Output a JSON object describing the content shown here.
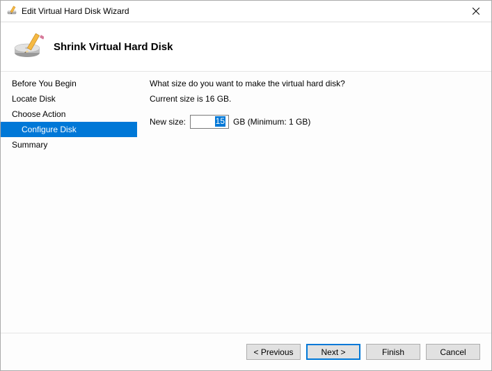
{
  "window": {
    "title": "Edit Virtual Hard Disk Wizard"
  },
  "page": {
    "heading": "Shrink Virtual Hard Disk"
  },
  "sidebar": {
    "items": [
      {
        "label": "Before You Begin",
        "indent": false,
        "active": false
      },
      {
        "label": "Locate Disk",
        "indent": false,
        "active": false
      },
      {
        "label": "Choose Action",
        "indent": false,
        "active": false
      },
      {
        "label": "Configure Disk",
        "indent": true,
        "active": true
      },
      {
        "label": "Summary",
        "indent": false,
        "active": false
      }
    ]
  },
  "content": {
    "question": "What size do you want to make the virtual hard disk?",
    "current_size_text": "Current size is 16 GB.",
    "new_size_label": "New size:",
    "new_size_value": "15",
    "unit_and_min": "GB (Minimum: 1 GB)"
  },
  "footer": {
    "previous": "< Previous",
    "next": "Next >",
    "finish": "Finish",
    "cancel": "Cancel"
  }
}
